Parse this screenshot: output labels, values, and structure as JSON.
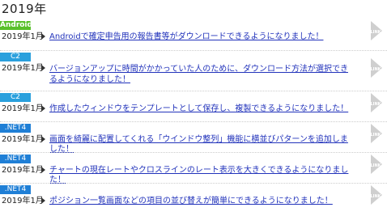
{
  "heading": {
    "year": "2019年"
  },
  "entries": [
    {
      "badge": "Android",
      "badge_color": "#58c02a",
      "date": "2019年1月",
      "text": "Androidで確定申告用の報告書等がダウンロードできるようになりました！",
      "link_label": "LINK"
    },
    {
      "badge": "C2",
      "badge_color": "#2aa0dd",
      "date": "2019年1月",
      "text": "バージョンアップに時間がかかっていた人のために、ダウンロード方法が選択できるようになりました！",
      "link_label": "LINK"
    },
    {
      "badge": "C2",
      "badge_color": "#2aa0dd",
      "date": "2019年1月",
      "text": "作成したウィンドウをテンプレートとして保存し、複製できるようになりました！",
      "link_label": "LINK"
    },
    {
      "badge": ".NET4",
      "badge_color": "#1f7fd6",
      "date": "2019年1月",
      "text": "画面を綺麗に配置してくれる「ウインドウ整列」機能に横並びパターンを追加しました！",
      "link_label": "LINK"
    },
    {
      "badge": ".NET4",
      "badge_color": "#1f7fd6",
      "date": "2019年1月",
      "text": "チャートの現在レートやクロスラインのレート表示を大きくできるようになりました！",
      "link_label": "LINK"
    },
    {
      "badge": ".NET4",
      "badge_color": "#1f7fd6",
      "date": "2019年1月",
      "text": "ポジション一覧画面などの項目の並び替えが簡単にできるようになりました！",
      "link_label": "LINK"
    }
  ]
}
